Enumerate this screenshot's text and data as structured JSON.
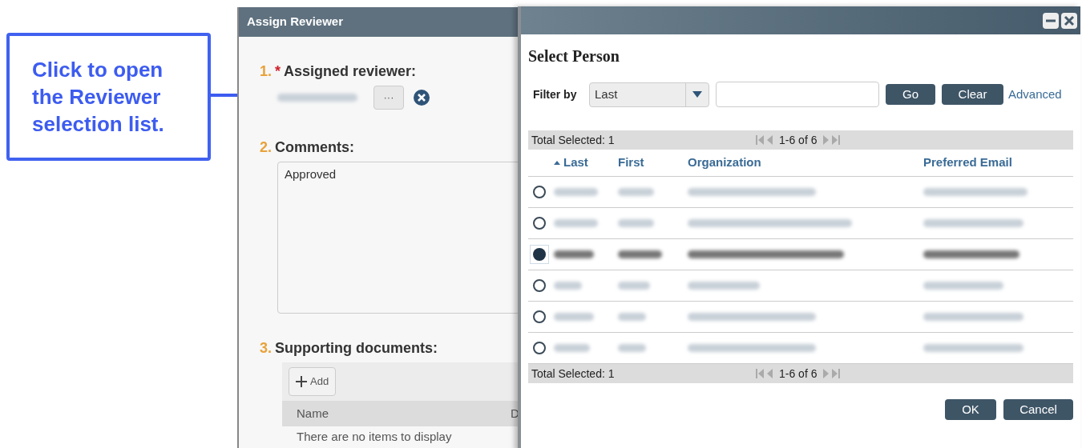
{
  "callout": {
    "text": "Click to open the Reviewer selection list."
  },
  "assign_window": {
    "title": "Assign Reviewer",
    "sections": [
      {
        "number": "1.",
        "required_mark": "*",
        "label": "Assigned reviewer:",
        "kind": "reviewer",
        "picker_button": "···"
      },
      {
        "number": "2.",
        "label": "Comments:",
        "kind": "comments",
        "value": "Approved"
      },
      {
        "number": "3.",
        "label": "Supporting documents:",
        "kind": "documents",
        "add_button": "Add",
        "columns": [
          "Name",
          "D"
        ],
        "empty_text": "There are no items to display"
      }
    ]
  },
  "select_dialog": {
    "title": "Select Person",
    "filter": {
      "label": "Filter by",
      "field": "Last",
      "buttons": [
        "Go",
        "Clear"
      ],
      "link": "Advanced"
    },
    "summary_top": {
      "selected": "Total Selected: 1",
      "range": "1-6 of 6"
    },
    "columns": [
      {
        "label": "Last",
        "sorted": true
      },
      {
        "label": "First",
        "sorted": false
      },
      {
        "label": "Organization",
        "sorted": false
      },
      {
        "label": "Preferred Email",
        "sorted": false
      }
    ],
    "rows": [
      {
        "selected": false
      },
      {
        "selected": false
      },
      {
        "selected": true
      },
      {
        "selected": false
      },
      {
        "selected": false
      },
      {
        "selected": false
      }
    ],
    "summary_bottom": {
      "selected": "Total Selected: 1",
      "range": "1-6 of 6"
    },
    "buttons": [
      "OK",
      "Cancel"
    ]
  }
}
